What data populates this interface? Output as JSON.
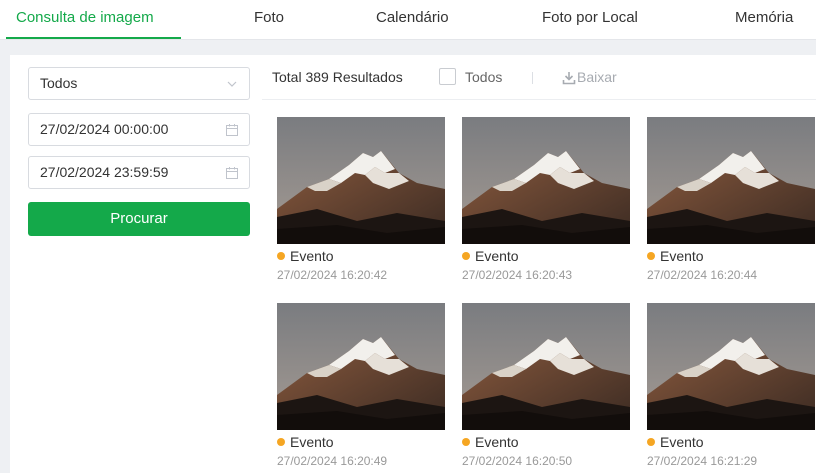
{
  "tabs": [
    {
      "label": "Consulta de imagem",
      "active": true
    },
    {
      "label": "Foto",
      "active": false
    },
    {
      "label": "Calendário",
      "active": false
    },
    {
      "label": "Foto por Local",
      "active": false
    },
    {
      "label": "Memória",
      "active": false
    }
  ],
  "filters": {
    "type_select": "Todos",
    "start_time": "27/02/2024 00:00:00",
    "end_time": "27/02/2024 23:59:59",
    "search_label": "Procurar"
  },
  "toolbar": {
    "total": "Total 389 Resultados",
    "select_all_label": "Todos",
    "download_label": "Baixar"
  },
  "results": [
    {
      "label": "Evento",
      "time": "27/02/2024 16:20:42"
    },
    {
      "label": "Evento",
      "time": "27/02/2024 16:20:43"
    },
    {
      "label": "Evento",
      "time": "27/02/2024 16:20:44"
    },
    {
      "label": "Evento",
      "time": "27/02/2024 16:20:49"
    },
    {
      "label": "Evento",
      "time": "27/02/2024 16:20:50"
    },
    {
      "label": "Evento",
      "time": "27/02/2024 16:21:29"
    }
  ],
  "colors": {
    "accent": "#14a94a",
    "event_dot": "#f5a623"
  }
}
